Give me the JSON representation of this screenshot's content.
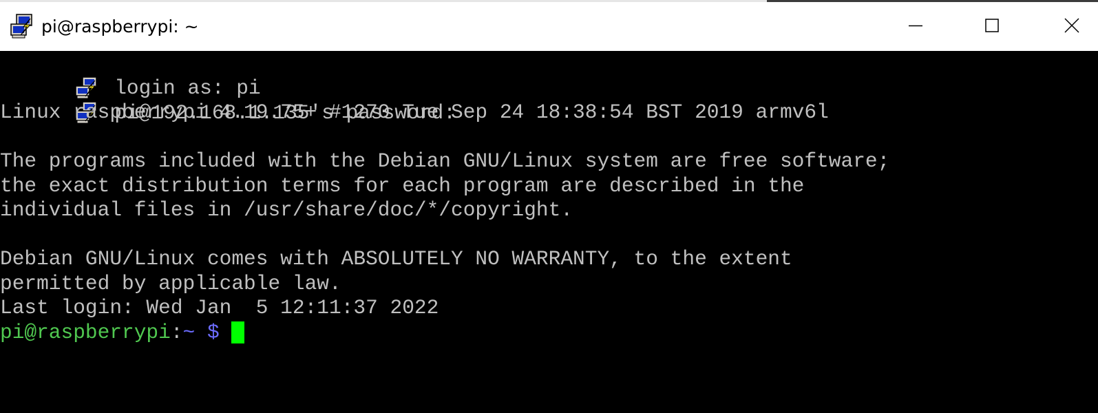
{
  "window": {
    "title": "pi@raspberrypi: ~",
    "icon": "putty-computers-icon",
    "controls": {
      "minimize": "minimize-icon",
      "maximize": "maximize-icon",
      "close": "close-icon"
    }
  },
  "terminal": {
    "colors": {
      "background": "#000000",
      "foreground": "#c0c0c0",
      "prompt_user": "#50c850",
      "prompt_path": "#6c6cff",
      "cursor": "#00ff00"
    },
    "login_lines": [
      {
        "icon": "putty-computers-icon",
        "text": "login as: pi"
      },
      {
        "icon": "putty-computers-icon",
        "text": "pi@192.168.1.135's password:"
      }
    ],
    "output_lines": [
      "Linux raspberrypi 4.19.75+ #1270 Tue Sep 24 18:38:54 BST 2019 armv6l",
      "",
      "The programs included with the Debian GNU/Linux system are free software;",
      "the exact distribution terms for each program are described in the",
      "individual files in /usr/share/doc/*/copyright.",
      "",
      "Debian GNU/Linux comes with ABSOLUTELY NO WARRANTY, to the extent",
      "permitted by applicable law.",
      "Last login: Wed Jan  5 12:11:37 2022"
    ],
    "prompt": {
      "user_host": "pi@raspberrypi",
      "separator": ":",
      "path": "~ $",
      "trailing": " "
    }
  }
}
